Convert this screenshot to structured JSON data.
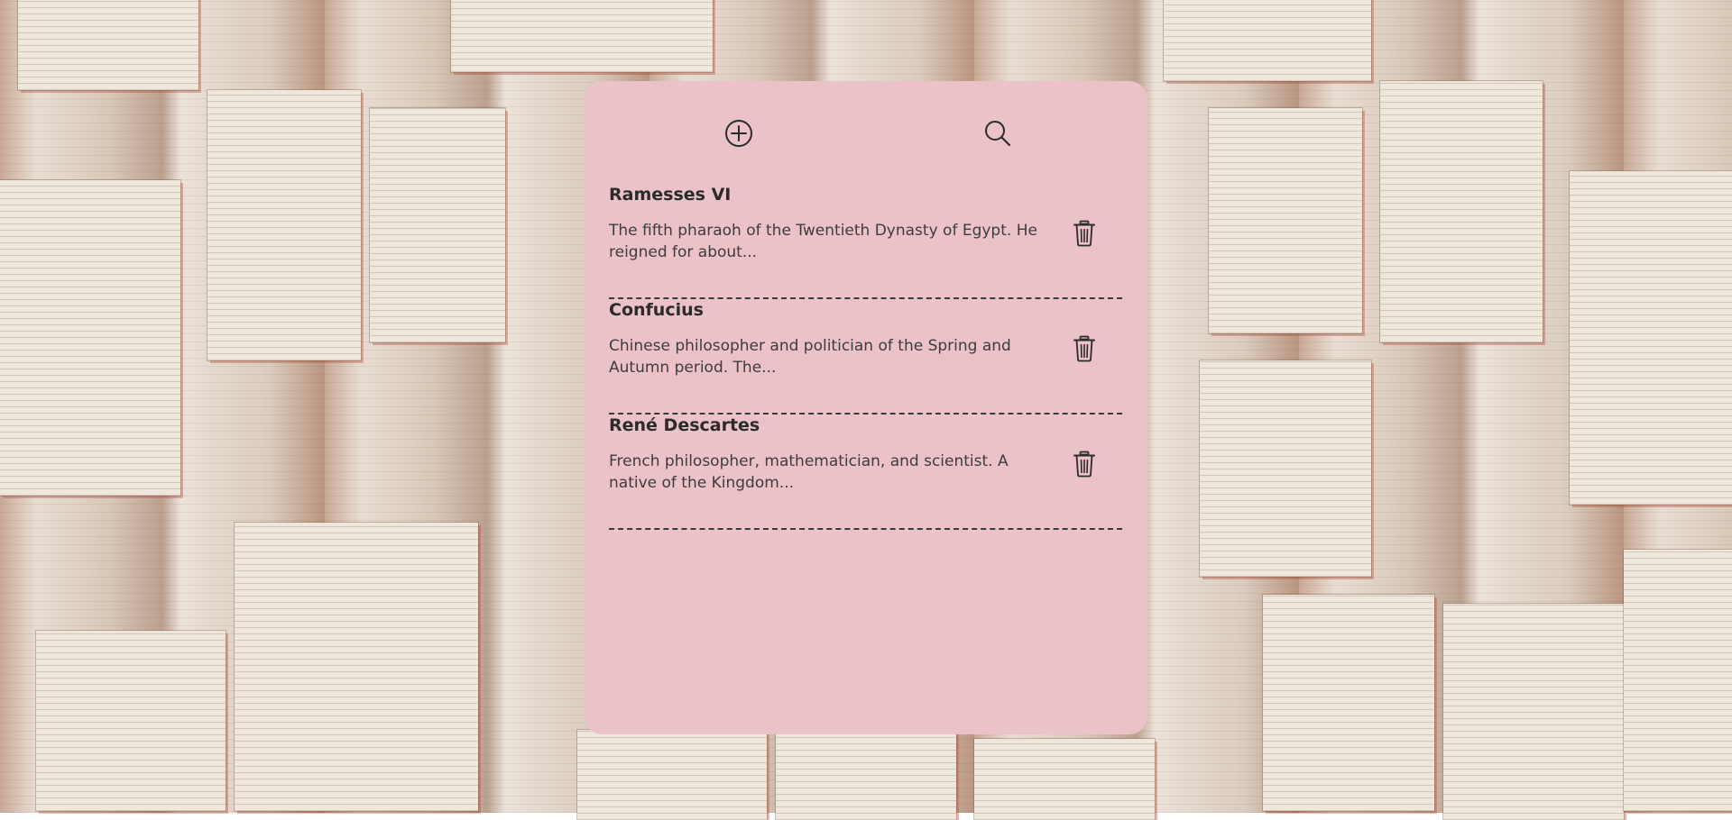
{
  "background": {
    "description_colors": {
      "paper": "#efe6dc",
      "page_edge": "#c8553d"
    }
  },
  "panel": {
    "background_color": "#ebc2c8",
    "toolbar": {
      "add_icon": "plus-circle-icon",
      "search_icon": "search-icon"
    },
    "notes": [
      {
        "title": "Ramesses VI",
        "body": "The fifth pharaoh of the Twentieth Dynasty of Egypt. He reigned for about...",
        "delete_icon": "trash-icon"
      },
      {
        "title": "Confucius",
        "body": "Chinese philosopher and politician of the Spring and Autumn period. The...",
        "delete_icon": "trash-icon"
      },
      {
        "title": "René Descartes",
        "body": "French philosopher, mathematician, and scientist. A native of the Kingdom...",
        "delete_icon": "trash-icon"
      }
    ]
  }
}
